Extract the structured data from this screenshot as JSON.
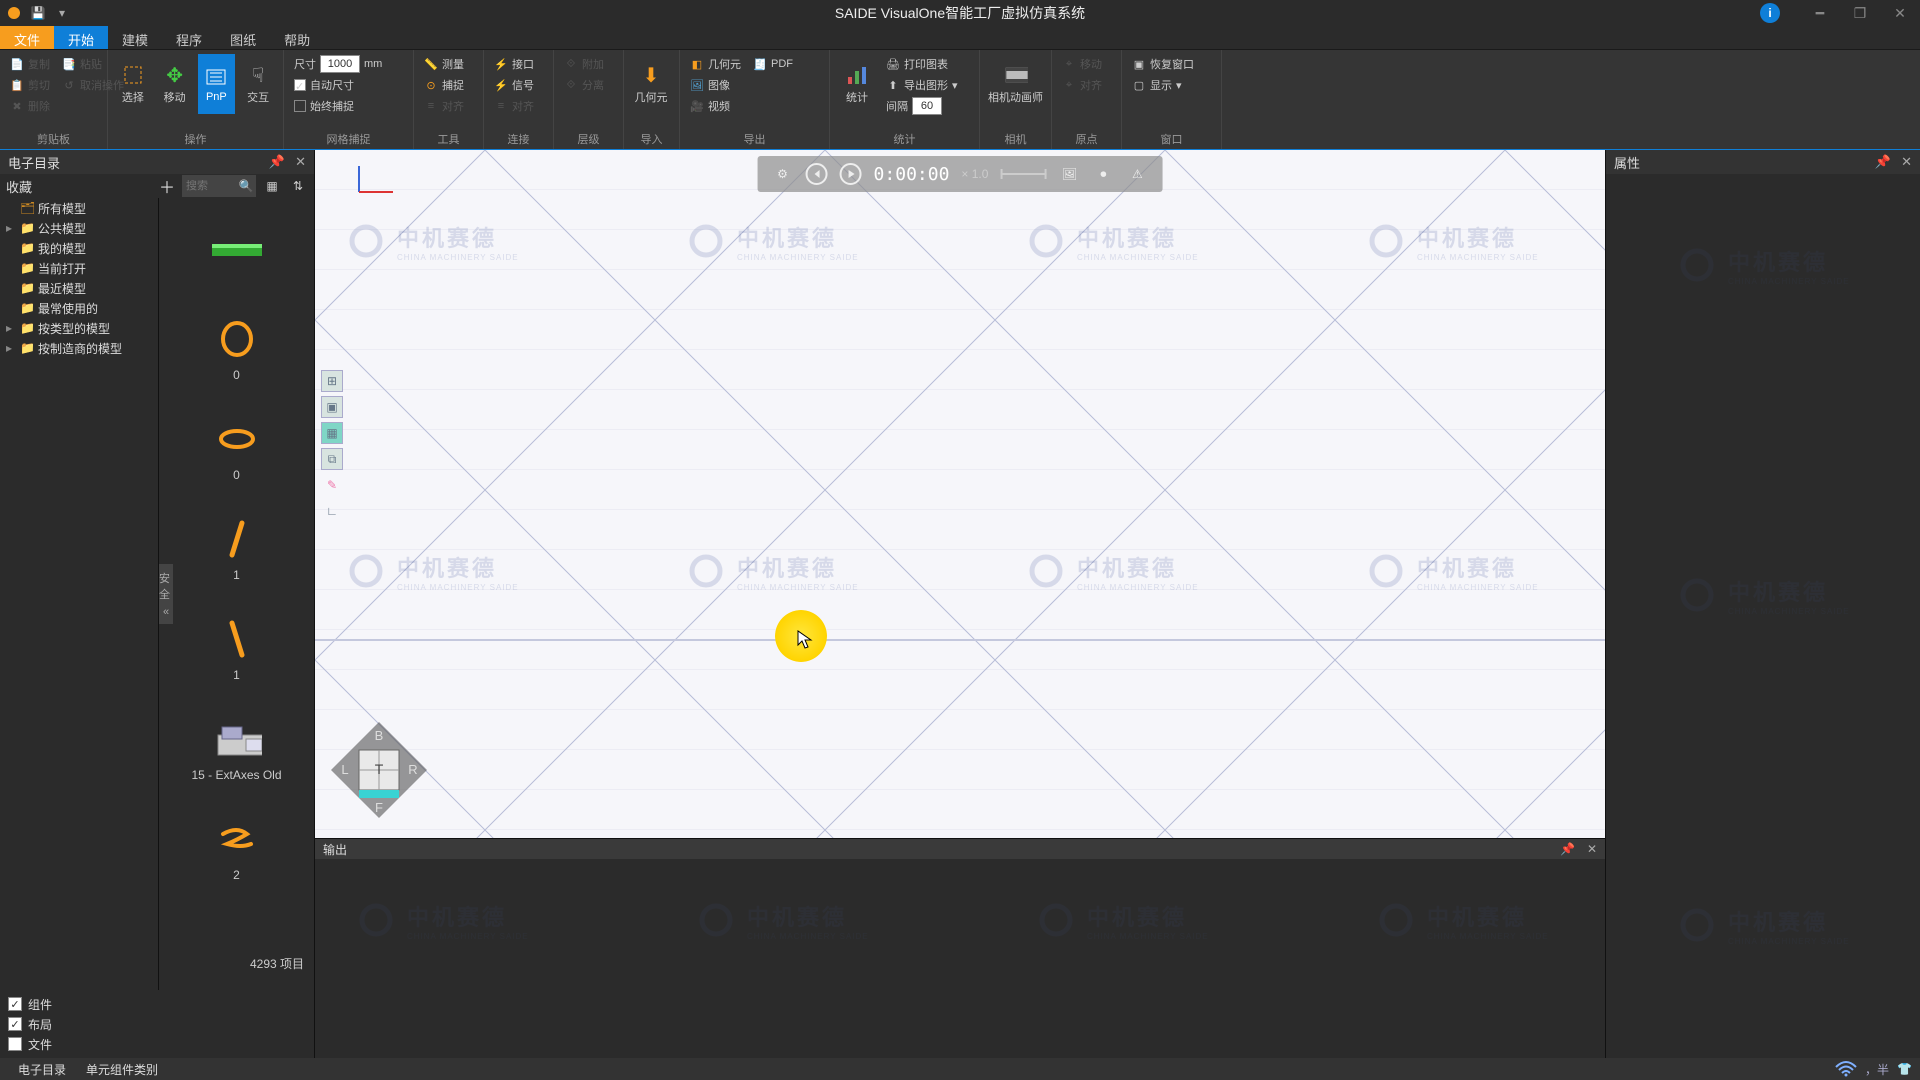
{
  "app": {
    "title": "SAIDE VisualOne智能工厂虚拟仿真系统"
  },
  "menubar": {
    "file": "文件",
    "items": [
      "开始",
      "建模",
      "程序",
      "图纸",
      "帮助"
    ],
    "active_index": 0
  },
  "ribbon": {
    "groups": {
      "clipboard": {
        "label": "剪贴板",
        "items": [
          "复制",
          "粘贴",
          "剪切",
          "取消操作",
          "删除"
        ]
      },
      "operate": {
        "label": "操作",
        "select": "选择",
        "move": "移动",
        "pnp": "PnP",
        "interact": "交互"
      },
      "size": {
        "dim": "尺寸",
        "dim_input": "1000",
        "unit": "mm",
        "auto": "自动尺寸",
        "snap_always": "始终捕捉",
        "grid_snap": "网格捕捉"
      },
      "tool": {
        "label": "工具",
        "measure": "测量",
        "snap": "捕捉",
        "align": "对齐"
      },
      "connect": {
        "label": "连接",
        "iface": "接口",
        "signal": "信号",
        "align": "对齐"
      },
      "layer": {
        "label": "层级",
        "attach": "附加",
        "detach": "分离"
      },
      "import": {
        "label": "导入",
        "geometry": "几何元"
      },
      "export": {
        "label": "导出",
        "geometry": "几何元",
        "image": "图像",
        "video": "视频",
        "pdf": "PDF"
      },
      "stats": {
        "label": "统计",
        "stats": "统计",
        "print_stats": "打印图表",
        "export_stats": "导出图形",
        "interval": "间隔",
        "interval_val": "60"
      },
      "camera": {
        "label": "相机",
        "cam": "相机动画师"
      },
      "origin": {
        "label": "原点",
        "move": "移动",
        "align": "对齐"
      },
      "window": {
        "label": "窗口",
        "restore": "恢复窗口",
        "show": "显示"
      }
    }
  },
  "left": {
    "title": "电子目录",
    "fav": "收藏",
    "search_ph": "搜索",
    "tree": [
      "所有模型",
      "公共模型",
      "我的模型",
      "当前打开",
      "最近模型",
      "最常使用的",
      "按类型的模型",
      "按制造商的模型"
    ],
    "thumbs": [
      {
        "label": "",
        "type": "conveyor"
      },
      {
        "label": "0",
        "type": "ring-upright"
      },
      {
        "label": "0",
        "type": "ring-tilt"
      },
      {
        "label": "1",
        "type": "stick-back"
      },
      {
        "label": "1",
        "type": "stick-forward"
      },
      {
        "label": "15 - ExtAxes Old",
        "type": "machine"
      },
      {
        "label": "2",
        "type": "two"
      }
    ],
    "count": "4293 项目",
    "vbar": "安全",
    "checks": [
      {
        "label": "组件",
        "on": true
      },
      {
        "label": "布局",
        "on": true
      },
      {
        "label": "文件",
        "on": false
      }
    ]
  },
  "timebar": {
    "time": "0:00:00",
    "speed": "× 1.0"
  },
  "viewcube": {
    "t": "T",
    "b": "B",
    "l": "L",
    "r": "R",
    "f": "F"
  },
  "right": {
    "title": "属性"
  },
  "output": {
    "title": "输出"
  },
  "status": {
    "tabs": [
      "电子目录",
      "单元组件类别"
    ],
    "ime": "，半"
  },
  "watermark": {
    "cn": "中机赛德",
    "en": "CHINA MACHINERY SAIDE"
  }
}
